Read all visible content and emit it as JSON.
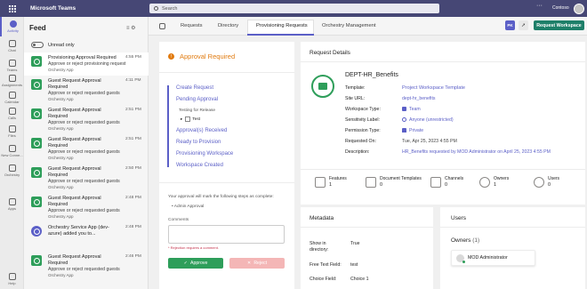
{
  "topbar": {
    "app_title": "Microsoft Teams",
    "search_placeholder": "Search",
    "more": "···",
    "org": "Contoso"
  },
  "rail": [
    {
      "label": "Activity",
      "icon": "bell-icon",
      "active": true
    },
    {
      "label": "Chat",
      "icon": "chat-icon"
    },
    {
      "label": "Teams",
      "icon": "teams-icon"
    },
    {
      "label": "Assignments",
      "icon": "assignments-icon"
    },
    {
      "label": "Calendar",
      "icon": "calendar-icon"
    },
    {
      "label": "Calls",
      "icon": "phone-icon"
    },
    {
      "label": "Files",
      "icon": "file-icon"
    },
    {
      "label": "New Conne...",
      "icon": "connector-icon"
    },
    {
      "label": "Orchestry",
      "icon": "orchestry-icon"
    },
    {
      "label": "Apps",
      "icon": "apps-icon"
    },
    {
      "label": "Help",
      "icon": "help-icon"
    }
  ],
  "feed": {
    "title": "Feed",
    "unread_only": "Unread only",
    "items": [
      {
        "title": "Provisioning Approval Required",
        "desc": "Approve or reject provisioning request",
        "source": "Orchestry App",
        "time": "4:55 PM",
        "active": true
      },
      {
        "title": "Guest Request Approval Required",
        "desc": "Approve or reject requested guests",
        "source": "Orchestry App",
        "time": "4:11 PM"
      },
      {
        "title": "Guest Request Approval Required",
        "desc": "Approve or reject requested guests",
        "source": "Orchestry App",
        "time": "2:51 PM"
      },
      {
        "title": "Guest Request Approval Required",
        "desc": "Approve or reject requested guests",
        "source": "Orchestry App",
        "time": "2:51 PM"
      },
      {
        "title": "Guest Request Approval Required",
        "desc": "Approve or reject requested guests",
        "source": "Orchestry App",
        "time": "2:50 PM"
      },
      {
        "title": "Guest Request Approval Required",
        "desc": "Approve or reject requested guests",
        "source": "Orchestry App",
        "time": "2:48 PM"
      },
      {
        "title": "Orchestry Service App (dev-azure) added you to...",
        "desc": "",
        "source": "",
        "time": "2:48 PM",
        "purple": true
      },
      {
        "title": "Guest Request Approval Required",
        "desc": "Approve or reject requested guests",
        "source": "Orchestry App",
        "time": "2:46 PM"
      }
    ]
  },
  "tabs": {
    "items": [
      "Requests",
      "Directory",
      "Provisioning Requests",
      "Orchestry Management"
    ],
    "active_index": 2,
    "user_chip": "PK",
    "request_workspace": "Request Workspace"
  },
  "approval": {
    "title": "Approval Required",
    "steps": [
      {
        "label": "Create Request"
      },
      {
        "label": "Pending Approval"
      },
      {
        "label": "Testing for Release",
        "sub": true
      },
      {
        "label": "Approval(s) Received"
      },
      {
        "label": "Ready to Provision"
      },
      {
        "label": "Provisioning Workspace"
      },
      {
        "label": "Workspace Created"
      }
    ],
    "checkbox_label": "Test",
    "note": "Your approval will mark the following steps as complete:",
    "bullet": "Admin Approval",
    "comments_label": "Comments",
    "comments_value": "",
    "error": "* Rejection requires a comment.",
    "approve": "Approve",
    "reject": "Reject"
  },
  "details": {
    "title": "Request Details",
    "name": "DEPT-HR_Benefits",
    "fields": [
      {
        "label": "Template:",
        "value": "Project Workspace Template",
        "icon": ""
      },
      {
        "label": "Site URL:",
        "value": "dept-hr_benefits",
        "icon": ""
      },
      {
        "label": "Workspace Type:",
        "value": "Team",
        "icon": "teams-icon"
      },
      {
        "label": "Sensitivity Label:",
        "value": "Anyone (unrestricted)",
        "icon": "sensitivity-icon"
      },
      {
        "label": "Permission Type:",
        "value": "Private",
        "icon": "lock-icon"
      },
      {
        "label": "Requested On:",
        "value": "Tue, Apr 25, 2023 4:55 PM",
        "icon": ""
      },
      {
        "label": "Description:",
        "value": "HR_Benefits requested by MOD Administrator on April 25, 2023 4:55 PM",
        "icon": ""
      }
    ],
    "stats": [
      {
        "label": "Features",
        "value": "1",
        "icon": "features-icon"
      },
      {
        "label": "Document Templates",
        "value": "0",
        "icon": "document-templates-icon"
      },
      {
        "label": "Channels",
        "value": "0",
        "icon": "channels-icon"
      },
      {
        "label": "Owners",
        "value": "1",
        "icon": "owners-icon"
      },
      {
        "label": "Users",
        "value": "0",
        "icon": "users-icon"
      }
    ]
  },
  "metadata": {
    "title": "Metadata",
    "rows": [
      {
        "label": "Show in directory:",
        "value": "True"
      },
      {
        "label": "Free Text Field:",
        "value": "test"
      },
      {
        "label": "Choice Field:",
        "value": "Choice 1"
      }
    ]
  },
  "users": {
    "title": "Users",
    "owners_label": "Owners",
    "owners_count": "(1)",
    "owner_name": "MOD Administrator"
  },
  "colors": {
    "brand": "#464775",
    "accent": "#5b5fc7",
    "approve": "#2e9e5a",
    "warning": "#e17b10",
    "reject": "#f4b6b6"
  }
}
